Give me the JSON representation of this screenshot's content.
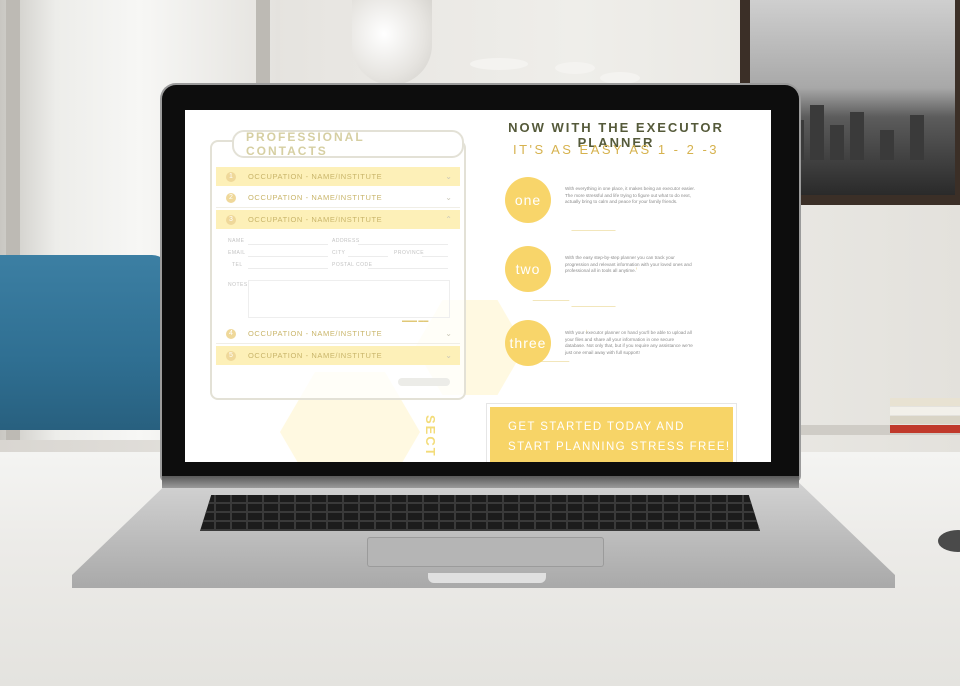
{
  "screen": {
    "contacts": {
      "title": "PROFESSIONAL CONTACTS",
      "rows": [
        {
          "num": "1",
          "label": "OCCUPATION - NAME/INSTITUTE",
          "chevron": "⌄"
        },
        {
          "num": "2",
          "label": "OCCUPATION - NAME/INSTITUTE",
          "chevron": "⌄"
        },
        {
          "num": "3",
          "label": "OCCUPATION - NAME/INSTITUTE",
          "chevron": "⌃"
        },
        {
          "num": "4",
          "label": "OCCUPATION - NAME/INSTITUTE",
          "chevron": "⌄"
        },
        {
          "num": "5",
          "label": "OCCUPATION - NAME/INSTITUTE",
          "chevron": "⌄"
        }
      ],
      "form": {
        "name": "NAME",
        "email": "EMAIL",
        "tel": "TEL",
        "address": "ADDRESS",
        "city": "CITY",
        "province": "PROVINCE",
        "postal": "POSTAL CODE",
        "notes": "NOTES"
      }
    },
    "sect_text": "SECT",
    "headline": "NOW WITH THE EXECUTOR PLANNER",
    "subhead": "IT'S AS EASY AS 1 - 2 -3",
    "steps": [
      {
        "word": "one",
        "text": "With everything in one place, it makes being an executor easier. The more stressful and life trying to figure out what to do next, actually bring to calm and peace for your family friends."
      },
      {
        "word": "two",
        "text": "With the easy step-by-step planner you can track your progression and relevant information with your loved ones and professional all in tools all anytime."
      },
      {
        "word": "three",
        "text": "With your executor planner on hand you'll be able to upload all your files and share all your information in one secure database. Not only that, but if you require any assistance we're just one email away with full support!"
      }
    ],
    "cta": {
      "line1": "GET STARTED TODAY AND",
      "line2": "START PLANNING STRESS FREE!"
    },
    "colors": {
      "accent": "#f8d56a",
      "highlight_row": "#fdf0b8",
      "headline": "#555a3a",
      "subhead": "#d6b24e"
    }
  }
}
